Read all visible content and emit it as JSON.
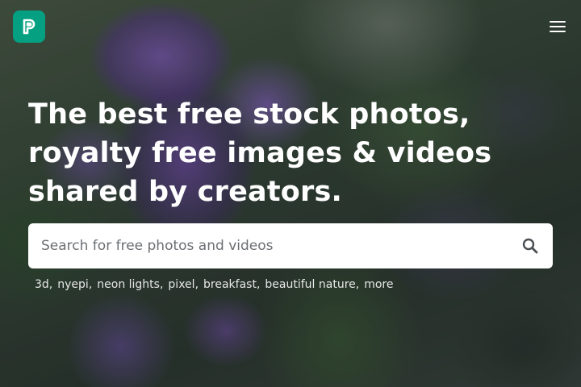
{
  "header": {
    "logo_icon": "pexels-logo-icon",
    "logo_color": "#05a081",
    "menu_icon": "hamburger-menu-icon"
  },
  "hero": {
    "headline": "The best free stock photos, royalty free images & videos shared by creators.",
    "search": {
      "placeholder": "Search for free photos and videos",
      "value": "",
      "icon": "search-icon"
    },
    "suggestions": [
      {
        "label": "3d"
      },
      {
        "label": "nyepi"
      },
      {
        "label": "neon lights"
      },
      {
        "label": "pixel"
      },
      {
        "label": "breakfast"
      },
      {
        "label": "beautiful nature"
      }
    ],
    "more_label": "more"
  }
}
